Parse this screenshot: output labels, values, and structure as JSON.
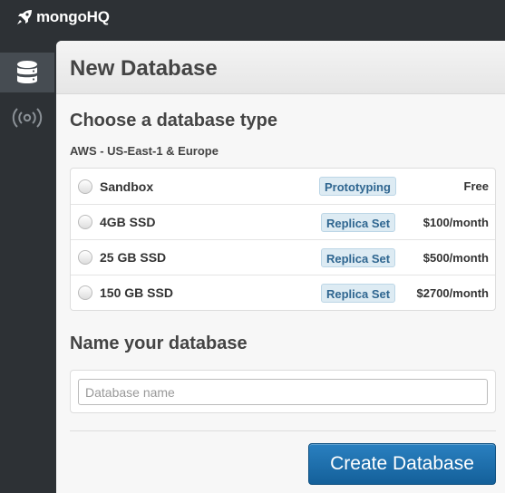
{
  "app": {
    "brand": "mongoHQ"
  },
  "sidebar": {
    "items": [
      {
        "icon": "database-icon"
      },
      {
        "icon": "signal-icon"
      }
    ]
  },
  "panel": {
    "title": "New Database"
  },
  "db_type": {
    "heading": "Choose a database type",
    "region": "AWS - US-East-1 & Europe",
    "options": [
      {
        "name": "Sandbox",
        "tag": "Prototyping",
        "price": "Free"
      },
      {
        "name": "4GB SSD",
        "tag": "Replica Set",
        "price": "$100/month"
      },
      {
        "name": "25 GB SSD",
        "tag": "Replica Set",
        "price": "$500/month"
      },
      {
        "name": "150 GB SSD",
        "tag": "Replica Set",
        "price": "$2700/month"
      }
    ]
  },
  "name_section": {
    "heading": "Name your database",
    "placeholder": "Database name",
    "value": ""
  },
  "actions": {
    "create_label": "Create Database"
  },
  "colors": {
    "sidebar": "#2d3135",
    "sidebar_active": "#464c52",
    "tag_bg": "#ddebf3",
    "tag_text": "#2f6690",
    "button": "#1a6aa6"
  }
}
